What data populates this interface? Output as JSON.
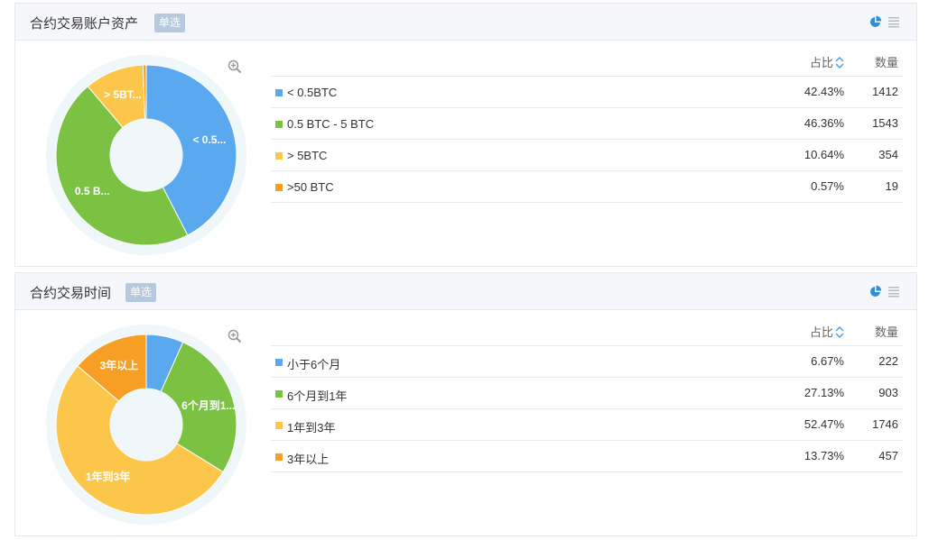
{
  "panels": [
    {
      "title": "合约交易账户资产",
      "tag": "单选",
      "col_percent": "占比",
      "col_count": "数量",
      "rows": [
        {
          "label": "< 0.5BTC",
          "percent": "42.43%",
          "count": "1412",
          "value": 42.43,
          "color": "#5aa9ee",
          "slice_label": "< 0.5..."
        },
        {
          "label": "0.5 BTC - 5 BTC",
          "percent": "46.36%",
          "count": "1543",
          "value": 46.36,
          "color": "#7bc243",
          "slice_label": "0.5 B..."
        },
        {
          "label": "> 5BTC",
          "percent": "10.64%",
          "count": "354",
          "value": 10.64,
          "color": "#fcc64b",
          "slice_label": "> 5BT..."
        },
        {
          "label": ">50 BTC",
          "percent": "0.57%",
          "count": "19",
          "value": 0.57,
          "color": "#f79e25",
          "slice_label": ""
        }
      ]
    },
    {
      "title": "合约交易时间",
      "tag": "单选",
      "col_percent": "占比",
      "col_count": "数量",
      "rows": [
        {
          "label": "小于6个月",
          "percent": "6.67%",
          "count": "222",
          "value": 6.67,
          "color": "#5aa9ee",
          "slice_label": ""
        },
        {
          "label": "6个月到1年",
          "percent": "27.13%",
          "count": "903",
          "value": 27.13,
          "color": "#7bc243",
          "slice_label": "6个月到1..."
        },
        {
          "label": "1年到3年",
          "percent": "52.47%",
          "count": "1746",
          "value": 52.47,
          "color": "#fcc64b",
          "slice_label": "1年到3年"
        },
        {
          "label": "3年以上",
          "percent": "13.73%",
          "count": "457",
          "value": 13.73,
          "color": "#f79e25",
          "slice_label": "3年以上"
        }
      ]
    }
  ]
}
